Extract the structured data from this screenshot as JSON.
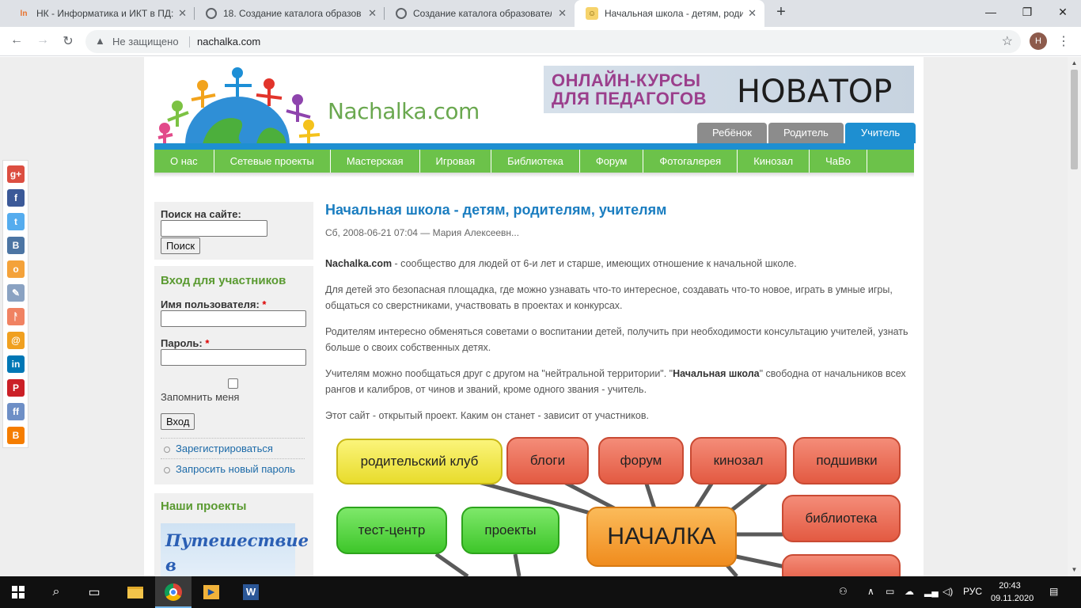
{
  "browser": {
    "tabs": [
      {
        "title": "НК - Информатика и ИКТ в ПД:",
        "favicon": "nk-icon"
      },
      {
        "title": "18. Создание каталога образов",
        "favicon": "globe-icon"
      },
      {
        "title": "Создание каталога образовател",
        "favicon": "globe-icon"
      },
      {
        "title": "Начальная школа - детям, роди",
        "favicon": "nachalka-icon"
      }
    ],
    "security_label": "Не защищено",
    "url": "nachalka.com",
    "profile_initial": "Н"
  },
  "site": {
    "logo_text": "Nachalka.com",
    "banner_line1": "ОНЛАЙН-КУРСЫ",
    "banner_line2": "ДЛЯ ПЕДАГОГОВ",
    "banner_brand": "НОВАТОР",
    "role_tabs": [
      "Ребёнок",
      "Родитель",
      "Учитель"
    ],
    "nav": [
      "О нас",
      "Сетевые проекты",
      "Мастерская",
      "Игровая",
      "Библиотека",
      "Форум",
      "Фотогалерея",
      "Кинозал",
      "ЧаВо"
    ]
  },
  "sidebar": {
    "search_label": "Поиск на сайте:",
    "search_button": "Поиск",
    "login_title": "Вход для участников",
    "username_label": "Имя пользователя:",
    "password_label": "Пароль:",
    "required_mark": "*",
    "remember_label": "Запомнить меня",
    "login_button": "Вход",
    "links": [
      "Зарегистрироваться",
      "Запросить новый пароль"
    ],
    "projects_title": "Наши проекты",
    "project_image_text": "Путешествие в"
  },
  "article": {
    "title": "Начальная школа - детям, родителям, учителям",
    "meta": "Сб, 2008-06-21 07:04 — Мария Алексеевн...",
    "p1_bold": "Nachalka.com",
    "p1_rest": " - сообщество для людей от 6-и лет и старше, имеющих отношение к начальной школе.",
    "p2": "Для детей это безопасная площадка, где можно узнавать что-то интересное, создавать что-то новое, играть в умные игры, общаться со сверстниками, участвовать в проектах и конкурсах.",
    "p3": "Родителям интересно обменяться советами о воспитании детей, получить при необходимости консультацию учителей, узнать больше о своих собственных детях.",
    "p4_start": "Учителям можно пообщаться друг с другом на \"нейтральной территории\". \"",
    "p4_bold": "Начальная школа",
    "p4_end": "\"  свободна от начальников всех рангов и калибров, от чинов и званий, кроме одного звания - учитель.",
    "p5": "Этот сайт - открытый проект. Каким он станет - зависит от участников."
  },
  "mindmap": {
    "center": "НАЧАЛКА",
    "nodes": [
      "родительский клуб",
      "блоги",
      "форум",
      "кинозал",
      "подшивки",
      "библиотека",
      "тест-центр",
      "проекты"
    ]
  },
  "taskbar": {
    "language": "РУС",
    "time": "20:43",
    "date": "09.11.2020"
  },
  "colors": {
    "nav_green": "#6cc24a",
    "accent_blue": "#1e8fd1",
    "title_blue": "#1a7dc0",
    "banner_purple": "#9b3f8c"
  }
}
